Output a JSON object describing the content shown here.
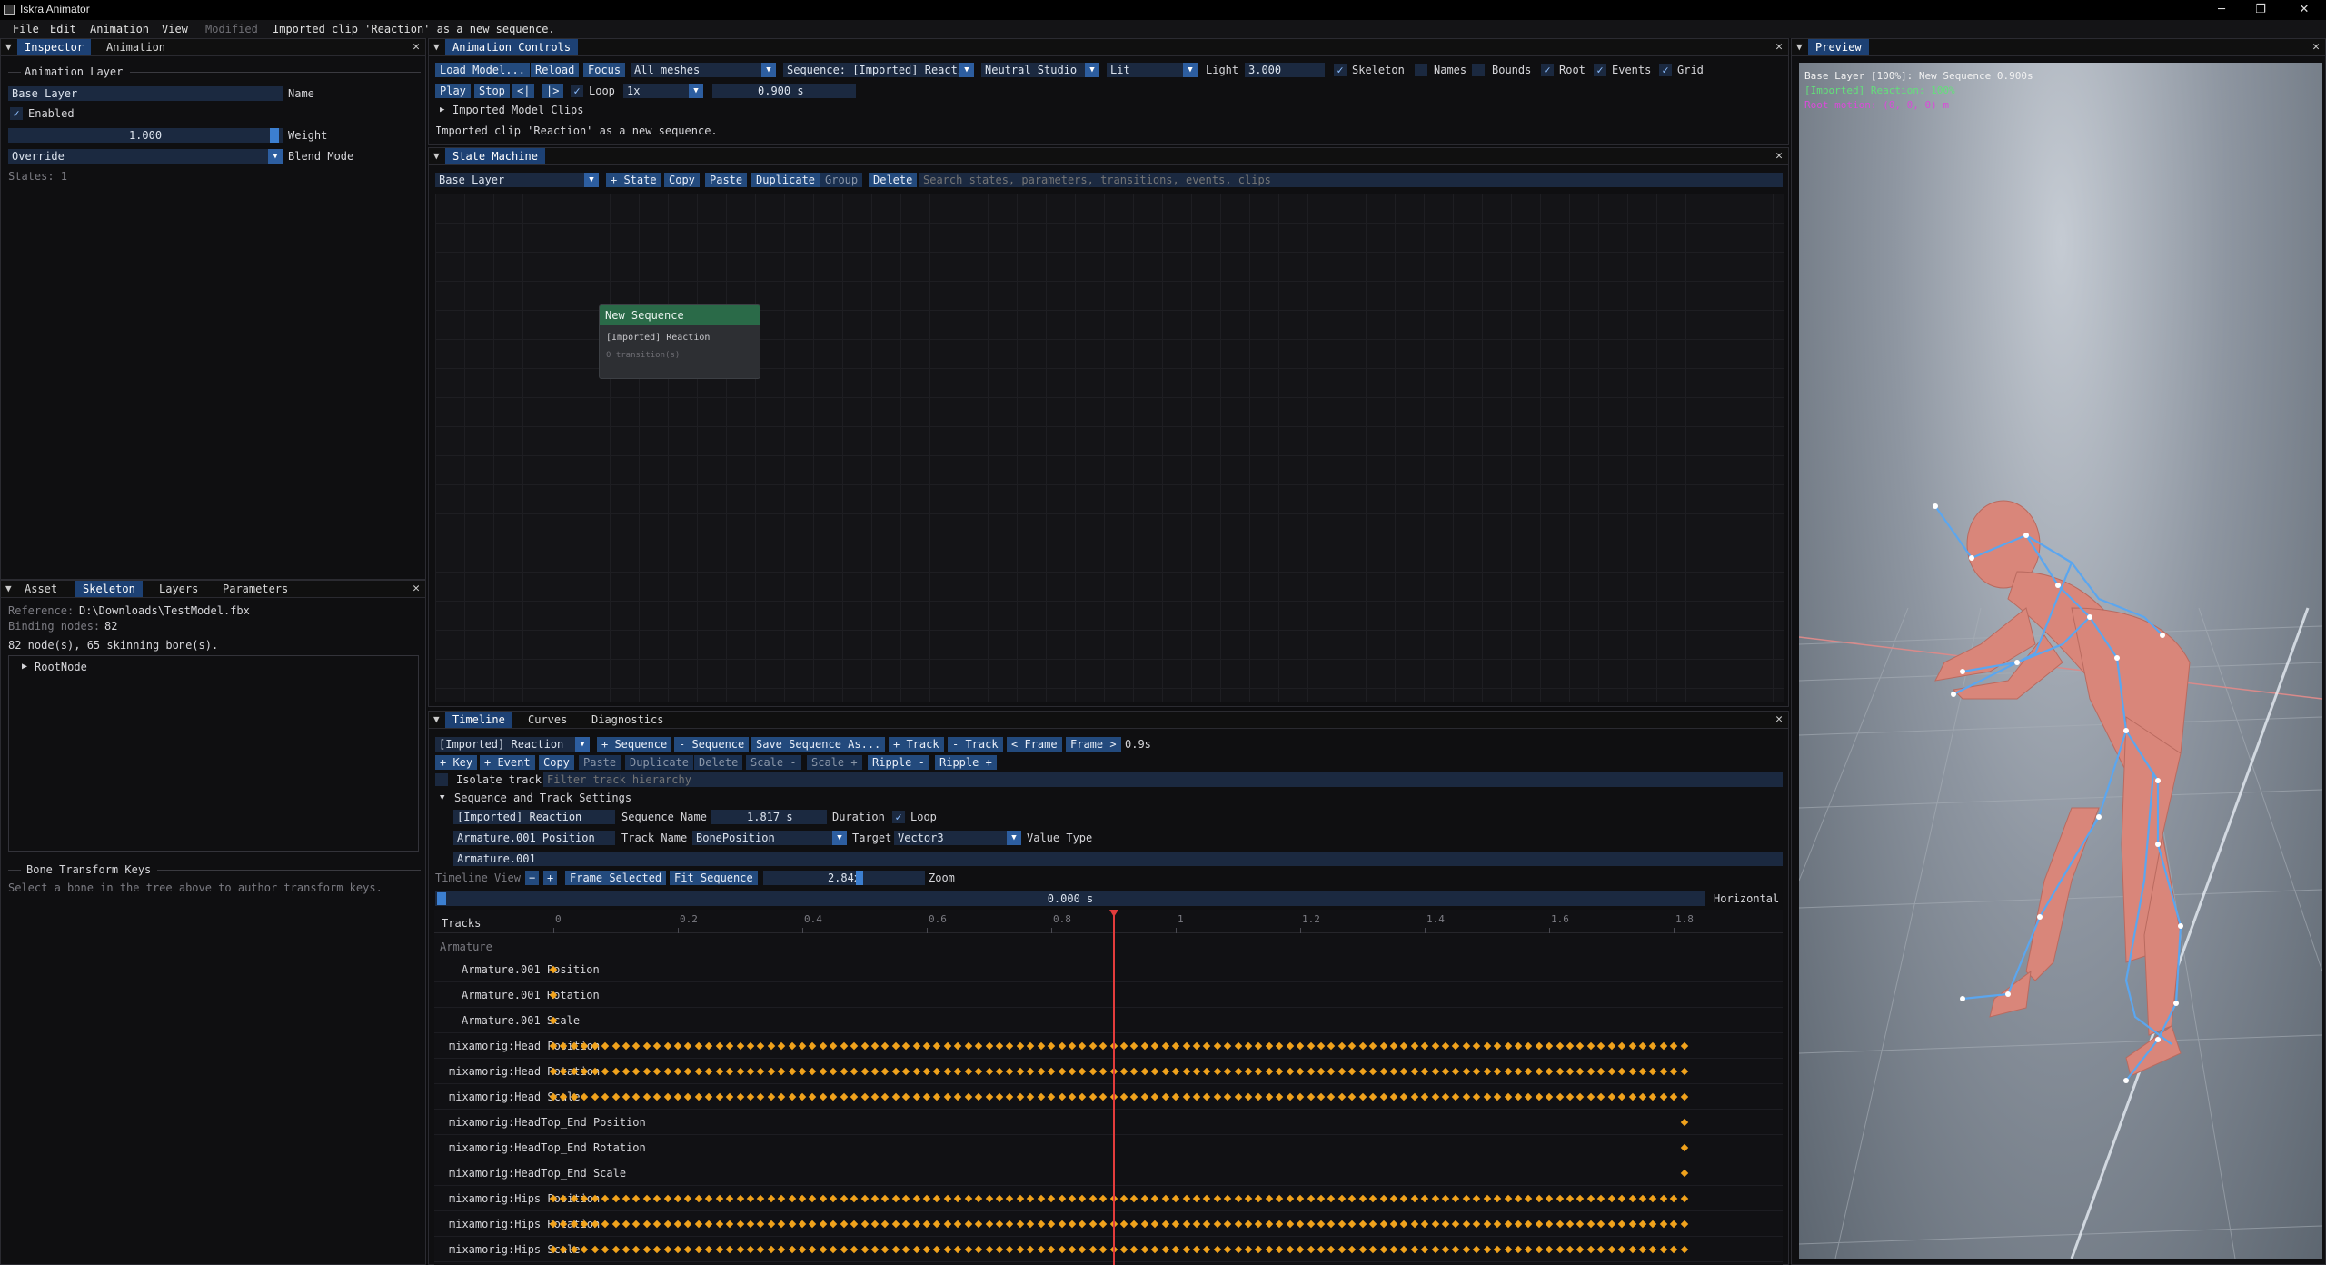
{
  "window": {
    "title": "Iskra Animator",
    "minimize": "─",
    "maximize": "❐",
    "close": "✕"
  },
  "menu": {
    "items": [
      "File",
      "Edit",
      "Animation",
      "View"
    ],
    "modified": "Modified",
    "status": "Imported clip 'Reaction' as a new sequence."
  },
  "inspector": {
    "tabs": [
      "Inspector",
      "Animation"
    ],
    "section": "Animation Layer",
    "layer_name": "Base Layer",
    "name_label": "Name",
    "enabled_label": "Enabled",
    "weight_value": "1.000",
    "weight_label": "Weight",
    "blend_mode": "Override",
    "blend_label": "Blend Mode",
    "states": "States: 1"
  },
  "asset_panel": {
    "tabs": [
      "Asset",
      "Skeleton",
      "Layers",
      "Parameters"
    ],
    "reference_label": "Reference:",
    "reference": "D:\\Downloads\\TestModel.fbx",
    "binding_label": "Binding nodes:",
    "binding": "82",
    "nodes_info": "82 node(s), 65 skinning bone(s).",
    "tree_root": "RootNode",
    "bone_section": "Bone Transform Keys",
    "bone_hint": "Select a bone in the tree above to author transform keys."
  },
  "anim_controls": {
    "title": "Animation Controls",
    "buttons": [
      "Load Model...",
      "Reload",
      "Focus"
    ],
    "meshes": "All meshes",
    "sequence": "Sequence: [Imported] Reacti",
    "environment": "Neutral Studio",
    "shading": "Lit",
    "light_label": "Light",
    "light_value": "3.000",
    "toggles": [
      "Skeleton",
      "Names",
      "Bounds",
      "Root",
      "Events",
      "Grid"
    ],
    "play": "Play",
    "stop": "Stop",
    "prev": "<|",
    "next": "|>",
    "loop": "Loop",
    "speed": "1x",
    "time": "0.900 s",
    "clips_tree": "Imported Model Clips",
    "message": "Imported clip 'Reaction' as a new sequence."
  },
  "state_machine": {
    "title": "State Machine",
    "layer": "Base Layer",
    "buttons": [
      "+ State",
      "Copy",
      "Paste",
      "Duplicate",
      "Group",
      "Delete"
    ],
    "search_placeholder": "Search states, parameters, transitions, events, clips",
    "node_title": "New Sequence",
    "node_clip": "[Imported] Reaction",
    "node_transitions": "0 transition(s)"
  },
  "timeline": {
    "tabs": [
      "Timeline",
      "Curves",
      "Diagnostics"
    ],
    "sequence": "[Imported] Reaction",
    "row1": [
      "+ Sequence",
      "- Sequence",
      "Save Sequence As...",
      "+ Track",
      "- Track",
      "< Frame",
      "Frame >"
    ],
    "frame_time": "0.9s",
    "row2": [
      "+ Key",
      "+ Event",
      "Copy",
      "Paste",
      "Duplicate",
      "Delete",
      "Scale -",
      "Scale +",
      "Ripple -",
      "Ripple +"
    ],
    "isolate": "Isolate track",
    "filter_placeholder": "Filter track hierarchy",
    "settings_header": "Sequence and Track Settings",
    "seq_name": "[Imported] Reaction",
    "seq_name_label": "Sequence Name",
    "duration": "1.817 s",
    "duration_label": "Duration",
    "loop_label": "Loop",
    "track_name": "Armature.001 Position",
    "track_name_label": "Track Name",
    "target": "BonePosition",
    "target_label": "Target",
    "value_type": "Vector3",
    "value_type_label": "Value Type",
    "node_path": "Armature.001",
    "view_label": "Timeline View",
    "minus": "−",
    "plus": "+",
    "frame_selected": "Frame Selected",
    "fit_sequence": "Fit Sequence",
    "zoom_value": "2.84x",
    "zoom_label": "Zoom",
    "scroll_time": "0.000 s",
    "horizontal": "Horizontal",
    "tracks_header": "Tracks",
    "ruler": [
      "0",
      "0.2",
      "0.4",
      "0.6",
      "0.8",
      "1",
      "1.2",
      "1.4",
      "1.6",
      "1.8"
    ],
    "playhead_time": 0.9,
    "group": "Armature",
    "tracks": [
      {
        "name": "Armature.001 Position",
        "keys": "single"
      },
      {
        "name": "Armature.001 Rotation",
        "keys": "single"
      },
      {
        "name": "Armature.001 Scale",
        "keys": "single"
      },
      {
        "name": "mixamorig:Head Position",
        "keys": "dense"
      },
      {
        "name": "mixamorig:Head Rotation",
        "keys": "dense"
      },
      {
        "name": "mixamorig:Head Scale",
        "keys": "dense"
      },
      {
        "name": "mixamorig:HeadTop_End Position",
        "keys": "end"
      },
      {
        "name": "mixamorig:HeadTop_End Rotation",
        "keys": "end"
      },
      {
        "name": "mixamorig:HeadTop_End Scale",
        "keys": "end"
      },
      {
        "name": "mixamorig:Hips Position",
        "keys": "dense"
      },
      {
        "name": "mixamorig:Hips Rotation",
        "keys": "dense"
      },
      {
        "name": "mixamorig:Hips Scale",
        "keys": "dense"
      }
    ],
    "key_color": "#f0a21c",
    "playhead_color": "#e23c3c"
  },
  "preview": {
    "title": "Preview",
    "line1": "Base Layer [100%]: New Sequence  0.900s",
    "line2": "[Imported] Reaction: 100%",
    "line3": "Root motion: (0, 0, 0) m"
  }
}
